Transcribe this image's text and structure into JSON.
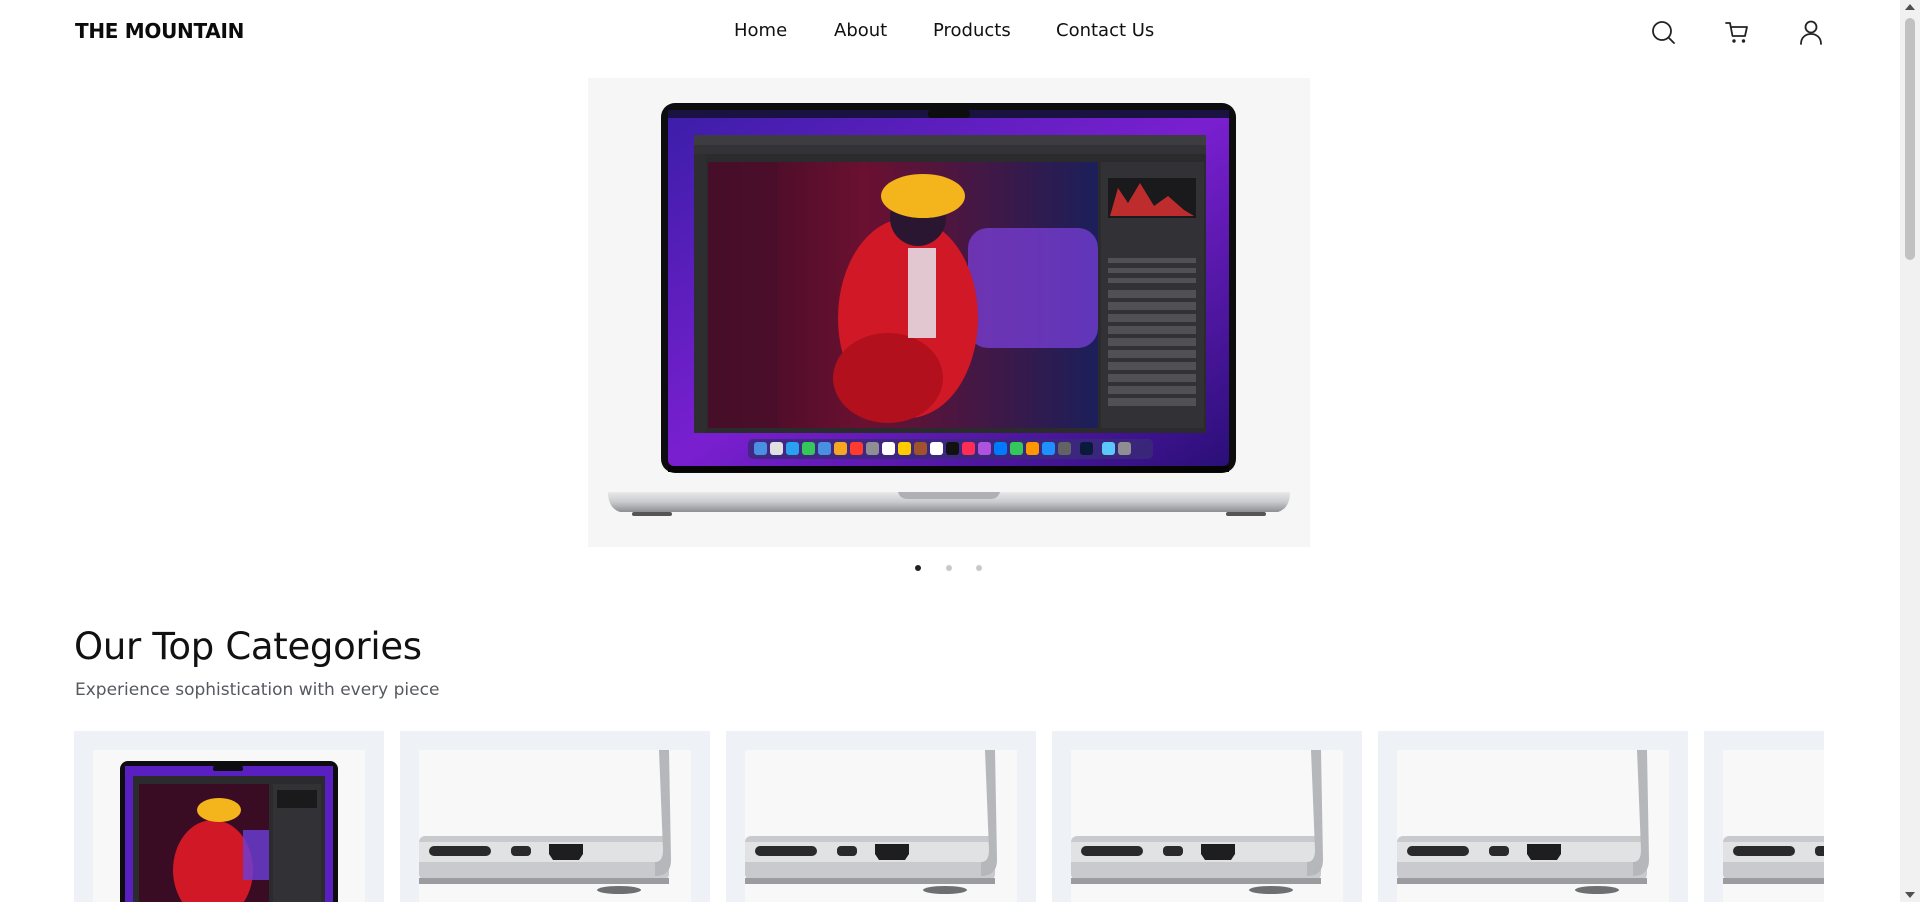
{
  "header": {
    "logo": "THE MOUNTAIN",
    "nav": [
      "Home",
      "About",
      "Products",
      "Contact Us"
    ],
    "icons": [
      "search-icon",
      "cart-icon",
      "user-icon"
    ]
  },
  "hero": {
    "image": "macbook-pro-photoshop",
    "slides": 3,
    "active_slide": 1
  },
  "categories": {
    "title": "Our Top Categories",
    "subtitle": "Experience sophistication with every piece",
    "cards": [
      {
        "image": "macbook-pro-screen"
      },
      {
        "image": "macbook-ports"
      },
      {
        "image": "macbook-ports"
      },
      {
        "image": "macbook-ports"
      },
      {
        "image": "macbook-ports"
      },
      {
        "image": "macbook-ports"
      }
    ]
  },
  "colors": {
    "text": "#111111",
    "subtitle": "#55595f",
    "card_bg": "#eef1f6",
    "hero_bg": "#f6f6f7",
    "screen_purple": "#5a1fc0"
  }
}
